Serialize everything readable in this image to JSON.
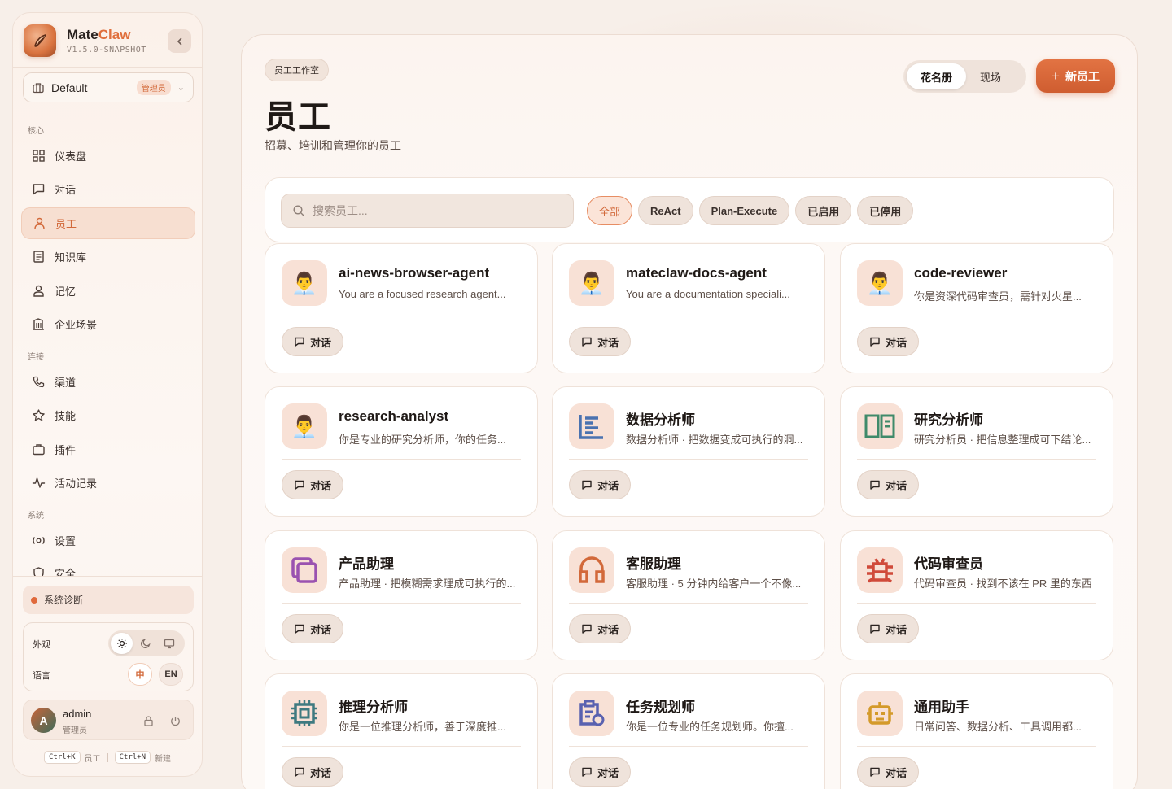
{
  "app": {
    "name_main": "Mate",
    "name_accent": "Claw",
    "version": "V1.5.0-SNAPSHOT",
    "accent_color": "#e06f3c"
  },
  "workspace": {
    "name": "Default",
    "role_badge": "管理员"
  },
  "nav": {
    "sections": {
      "core": "核心",
      "connect": "连接",
      "system": "系统"
    },
    "items": [
      {
        "label": "仪表盘",
        "icon": "grid-icon"
      },
      {
        "label": "对话",
        "icon": "message-icon"
      },
      {
        "label": "员工",
        "icon": "user-icon",
        "active": true
      },
      {
        "label": "知识库",
        "icon": "document-icon"
      },
      {
        "label": "记忆",
        "icon": "memory-icon"
      },
      {
        "label": "企业场景",
        "icon": "building-icon"
      },
      {
        "label": "渠道",
        "icon": "phone-icon"
      },
      {
        "label": "技能",
        "icon": "star-icon"
      },
      {
        "label": "插件",
        "icon": "briefcase-icon"
      },
      {
        "label": "活动记录",
        "icon": "activity-icon"
      },
      {
        "label": "设置",
        "icon": "settings-icon"
      },
      {
        "label": "安全",
        "icon": "shield-icon"
      }
    ]
  },
  "diagnostics": {
    "label": "系统诊断",
    "status_color": "#e06a3c"
  },
  "prefs": {
    "appearance_label": "外观",
    "language_label": "语言",
    "lang_zh": "中",
    "lang_en": "EN",
    "theme_selected": "light"
  },
  "user": {
    "name": "admin",
    "role": "管理员",
    "initial": "A"
  },
  "shortcuts": [
    {
      "key": "Ctrl+K",
      "label": "员工"
    },
    {
      "key": "Ctrl+N",
      "label": "新建"
    }
  ],
  "page": {
    "breadcrumb": "员工工作室",
    "title": "员工",
    "subtitle": "招募、培训和管理你的员工",
    "view_roster": "花名册",
    "view_live": "现场",
    "new_button": "新员工"
  },
  "filters": {
    "search_placeholder": "搜索员工...",
    "chips": [
      "全部",
      "ReAct",
      "Plan-Execute",
      "已启用",
      "已停用"
    ],
    "active_chip": "全部"
  },
  "chat_label": "对话",
  "agents": [
    {
      "name": "ai-news-browser-agent",
      "desc": "You are a focused research agent...",
      "icon": "person-emoji-icon"
    },
    {
      "name": "mateclaw-docs-agent",
      "desc": "You are a documentation speciali...",
      "icon": "person-emoji-icon"
    },
    {
      "name": "code-reviewer",
      "desc": "你是资深代码审查员，需针对火星...",
      "icon": "person-emoji-icon"
    },
    {
      "name": "research-analyst",
      "desc": "你是专业的研究分析师，你的任务...",
      "icon": "person-emoji-icon"
    },
    {
      "name": "数据分析师",
      "desc": "数据分析师 · 把数据变成可执行的洞...",
      "icon": "data-list-icon",
      "icon_color": "#4a72b0"
    },
    {
      "name": "研究分析师",
      "desc": "研究分析员 · 把信息整理成可下结论...",
      "icon": "open-book-icon",
      "icon_color": "#3f8a6a"
    },
    {
      "name": "产品助理",
      "desc": "产品助理 · 把模糊需求理成可执行的...",
      "icon": "layers-icon",
      "icon_color": "#9a52b0"
    },
    {
      "name": "客服助理",
      "desc": "客服助理 · 5 分钟内给客户一个不像...",
      "icon": "headphones-icon",
      "icon_color": "#d2693a"
    },
    {
      "name": "代码审查员",
      "desc": "代码审查员 · 找到不该在 PR 里的东西",
      "icon": "bug-icon",
      "icon_color": "#d04a3a"
    },
    {
      "name": "推理分析师",
      "desc": "你是一位推理分析师，善于深度推...",
      "icon": "chip-icon",
      "icon_color": "#3f7a80"
    },
    {
      "name": "任务规划师",
      "desc": "你是一位专业的任务规划师。你擅...",
      "icon": "clipboard-icon",
      "icon_color": "#5a62b0"
    },
    {
      "name": "通用助手",
      "desc": "日常问答、数据分析、工具调用都...",
      "icon": "robot-icon",
      "icon_color": "#d49a2a"
    }
  ]
}
